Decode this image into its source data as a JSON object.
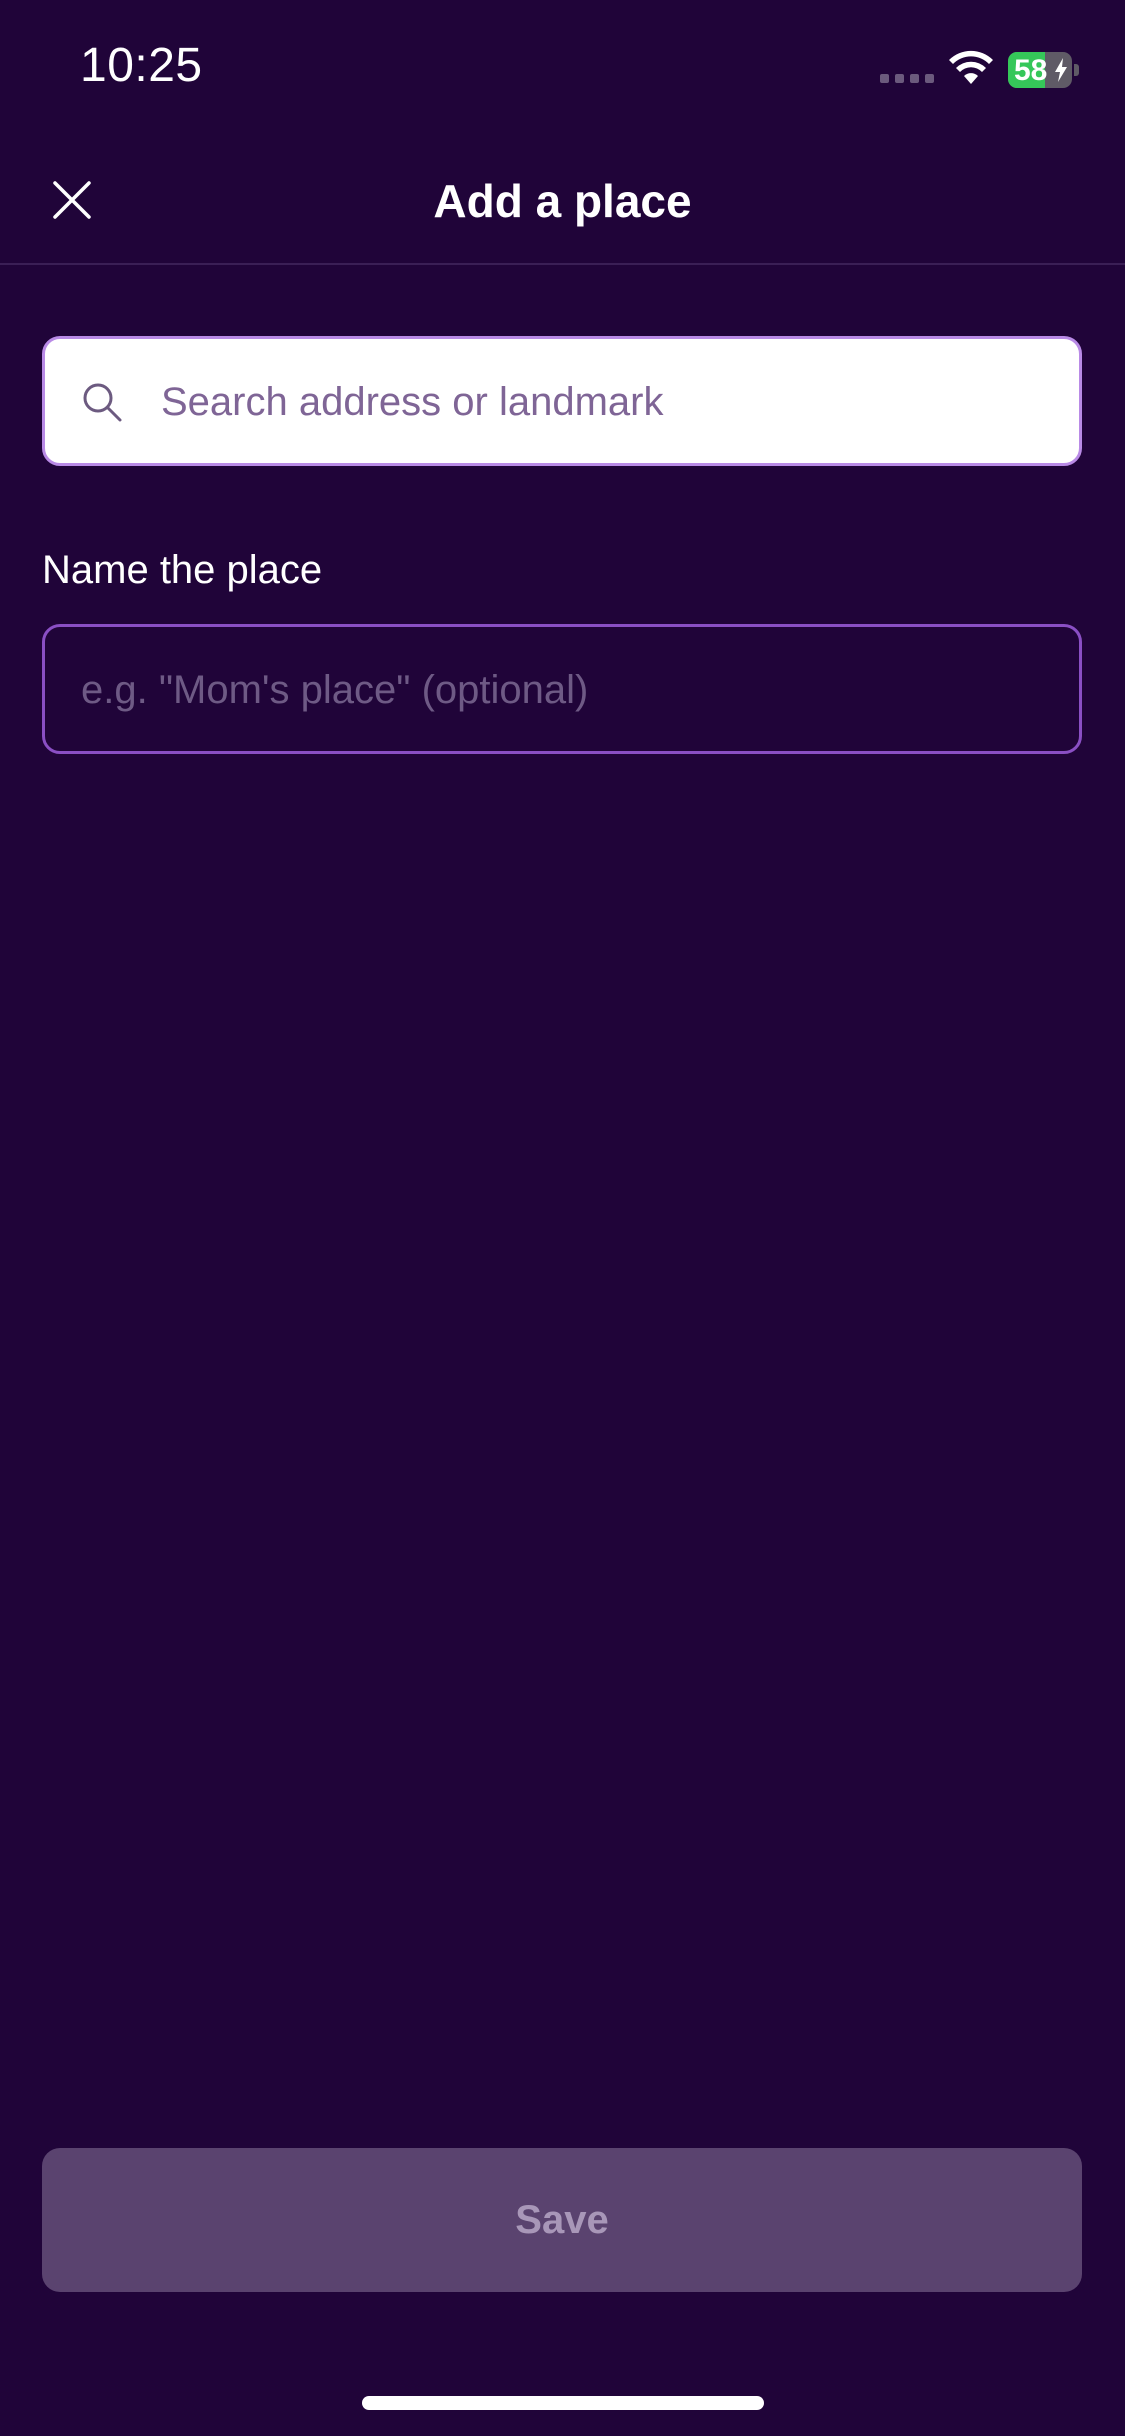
{
  "status_bar": {
    "time": "10:25",
    "battery_percent": "58",
    "battery_level": 0.58,
    "icons": [
      "signal-dots-icon",
      "wifi-icon",
      "battery-charging-icon"
    ]
  },
  "header": {
    "title": "Add a place",
    "close_icon": "close-icon"
  },
  "search": {
    "placeholder": "Search address or landmark",
    "value": "",
    "icon": "search-icon"
  },
  "name_field": {
    "label": "Name the place",
    "placeholder": "e.g. \"Mom's place\" (optional)",
    "value": ""
  },
  "save_button": {
    "label": "Save",
    "enabled": false
  },
  "colors": {
    "background": "#200439",
    "accent_border": "#b98ae6",
    "field_border": "#8a4fc4",
    "button_disabled": "#5a436f",
    "battery_green": "#35c759"
  }
}
